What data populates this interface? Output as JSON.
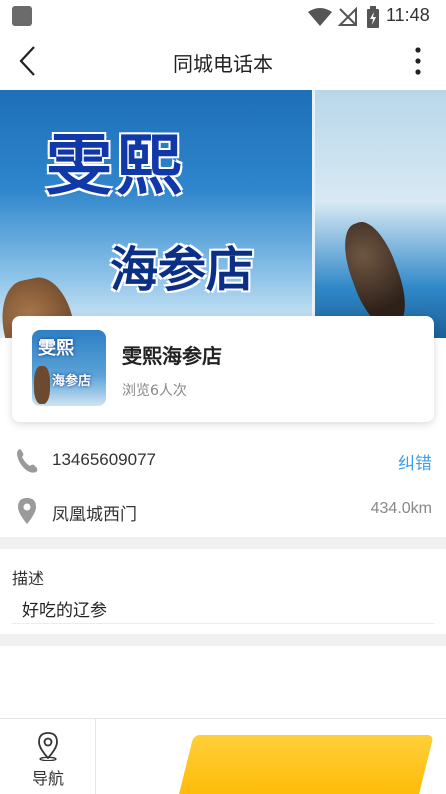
{
  "status_bar": {
    "time": "11:48"
  },
  "header": {
    "title": "同城电话本"
  },
  "banner": {
    "line1": "雯熙",
    "line2": "海参店"
  },
  "shop": {
    "thumb_line1": "雯熙",
    "thumb_line2": "海参店",
    "name": "雯熙海参店",
    "views": "浏览6人次"
  },
  "contact": {
    "phone": "13465609077",
    "correct_label": "纠错"
  },
  "location": {
    "address": "凤凰城西门",
    "distance": "434.0km"
  },
  "description": {
    "label": "描述",
    "text": "好吃的辽参"
  },
  "bottom_bar": {
    "nav_label": "导航"
  },
  "colors": {
    "accent_link": "#3f9fe8",
    "call_button": "#ffb800"
  }
}
